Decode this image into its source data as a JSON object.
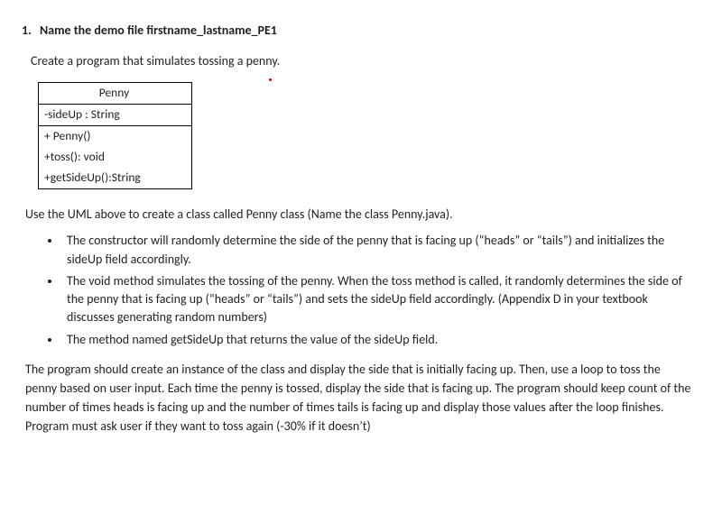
{
  "heading": {
    "number": "1.",
    "text": "Name the demo file firstname_lastname_PE1"
  },
  "intro": "Create a program that simulates tossing a penny.",
  "uml": {
    "className": "Penny",
    "attribute": "-sideUp : String",
    "methods": [
      "+ Penny()",
      "+toss(): void",
      "+getSideUp():String"
    ]
  },
  "afterUml": "Use the UML above to create a class called Penny class (Name the class Penny.java).",
  "bullets": [
    "The constructor will randomly determine the side of the penny that is facing up (“heads” or “tails”) and initializes the sideUp field accordingly.",
    "The void method simulates the tossing of the penny. When the toss method is called, it randomly determines the side of the penny that is facing up (“heads” or “tails”) and sets the sideUp field accordingly. (Appendix D in your textbook discusses generating random numbers)",
    "The method named getSideUp that returns the value of the sideUp field."
  ],
  "closing": "The program should create an instance of the class and display the side that is initially facing up. Then, use a loop to toss the penny based on user input.  Each time the penny is tossed, display the side that is facing up. The program should keep count of the number of times heads is facing up and the number of times tails is facing up and display those values after the loop finishes. Program must ask user if they want to toss again (-30% if it doesn’t)"
}
